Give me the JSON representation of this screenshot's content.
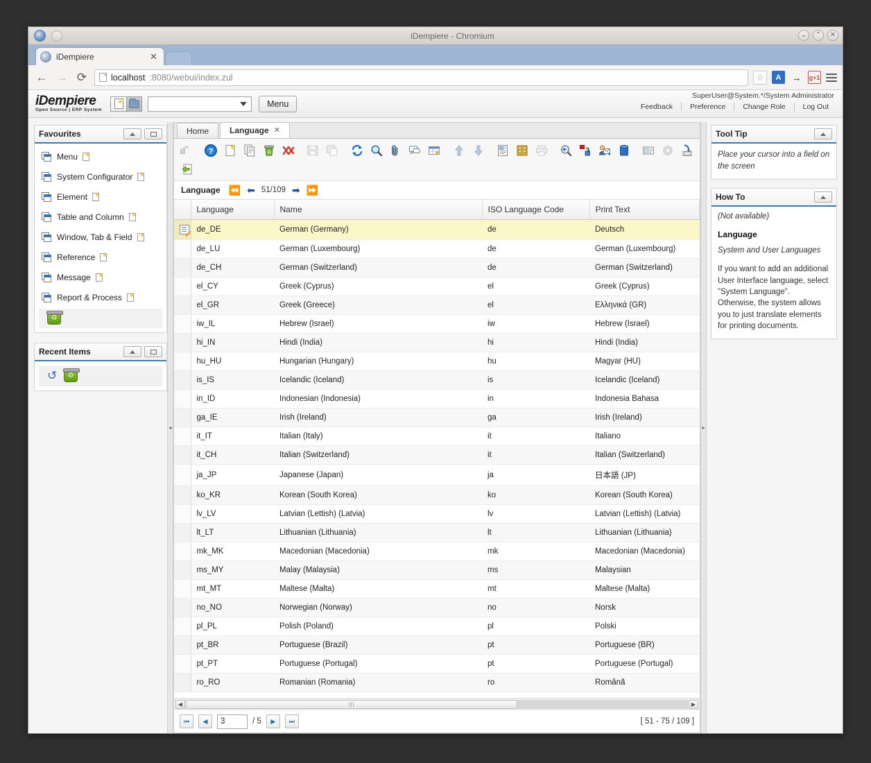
{
  "window": {
    "title": "iDempiere - Chromium",
    "buttons": {
      "minimize": "⌄",
      "maximize": "⌃",
      "close": "✕"
    }
  },
  "browser": {
    "tab_title": "iDempiere",
    "tab_close": "✕",
    "back": "←",
    "forward": "→",
    "reload": "⟳",
    "url_host": "localhost",
    "url_path": ":8080/webui/index.zul",
    "star": "☆",
    "ext_translate": "A",
    "ext_mobile": "→",
    "ext_gplus": "g+1"
  },
  "app_header": {
    "logo_main": "iDempiere",
    "logo_sub": "Open Source | ERP System",
    "search_value": "",
    "menu_button": "Menu",
    "user": "SuperUser@System.*/System Administrator",
    "links": [
      "Feedback",
      "Preference",
      "Change Role",
      "Log Out"
    ]
  },
  "favourites": {
    "title": "Favourites",
    "items": [
      {
        "label": "Menu"
      },
      {
        "label": "System Configurator"
      },
      {
        "label": "Element"
      },
      {
        "label": "Table and Column"
      },
      {
        "label": "Window, Tab & Field"
      },
      {
        "label": "Reference"
      },
      {
        "label": "Message"
      },
      {
        "label": "Report & Process"
      }
    ]
  },
  "recent_items": {
    "title": "Recent Items"
  },
  "tabs": [
    {
      "label": "Home",
      "active": false,
      "closable": false
    },
    {
      "label": "Language",
      "active": true,
      "closable": true,
      "close": "✕"
    }
  ],
  "toolbar": {
    "icons": [
      "ignore-icon",
      "help-icon",
      "new-record-icon",
      "copy-record-icon",
      "delete-record-icon",
      "delete-selection-icon",
      "save-icon",
      "save-create-icon",
      "refresh-icon",
      "find-icon",
      "attachment-icon",
      "chat-icon",
      "grid-toggle-icon",
      "parent-record-icon",
      "detail-record-icon",
      "report-icon",
      "archive-icon",
      "print-icon",
      "zoom-across-icon",
      "active-workflow-icon",
      "request-icon",
      "product-info-icon",
      "customize-icon",
      "process-icon",
      "export-icon",
      "exit-icon"
    ]
  },
  "record_nav": {
    "label": "Language",
    "first": "⏮",
    "prev": "←",
    "counter": "51/109",
    "next": "→",
    "last": "⏭"
  },
  "grid": {
    "columns": [
      "Language",
      "Name",
      "ISO Language Code",
      "Print Text"
    ],
    "rows": [
      {
        "selected": true,
        "cells": [
          "de_DE",
          "German (Germany)",
          "de",
          "Deutsch"
        ]
      },
      {
        "cells": [
          "de_LU",
          "German (Luxembourg)",
          "de",
          "German (Luxembourg)"
        ]
      },
      {
        "cells": [
          "de_CH",
          "German (Switzerland)",
          "de",
          "German (Switzerland)"
        ]
      },
      {
        "cells": [
          "el_CY",
          "Greek (Cyprus)",
          "el",
          "Greek (Cyprus)"
        ]
      },
      {
        "cells": [
          "el_GR",
          "Greek (Greece)",
          "el",
          "Ελληνικά (GR)"
        ]
      },
      {
        "cells": [
          "iw_IL",
          "Hebrew (Israel)",
          "iw",
          "Hebrew (Israel)"
        ]
      },
      {
        "cells": [
          "hi_IN",
          "Hindi (India)",
          "hi",
          "Hindi (India)"
        ]
      },
      {
        "cells": [
          "hu_HU",
          "Hungarian (Hungary)",
          "hu",
          "Magyar (HU)"
        ]
      },
      {
        "cells": [
          "is_IS",
          "Icelandic (Iceland)",
          "is",
          "Icelandic (Iceland)"
        ]
      },
      {
        "cells": [
          "in_ID",
          "Indonesian (Indonesia)",
          "in",
          "Indonesia Bahasa"
        ]
      },
      {
        "cells": [
          "ga_IE",
          "Irish (Ireland)",
          "ga",
          "Irish (Ireland)"
        ]
      },
      {
        "cells": [
          "it_IT",
          "Italian (Italy)",
          "it",
          "Italiano"
        ]
      },
      {
        "cells": [
          "it_CH",
          "Italian (Switzerland)",
          "it",
          "Italian (Switzerland)"
        ]
      },
      {
        "cells": [
          "ja_JP",
          "Japanese (Japan)",
          "ja",
          "日本語 (JP)"
        ]
      },
      {
        "cells": [
          "ko_KR",
          "Korean (South Korea)",
          "ko",
          "Korean (South Korea)"
        ]
      },
      {
        "cells": [
          "lv_LV",
          "Latvian (Lettish) (Latvia)",
          "lv",
          "Latvian (Lettish) (Latvia)"
        ]
      },
      {
        "cells": [
          "lt_LT",
          "Lithuanian (Lithuania)",
          "lt",
          "Lithuanian (Lithuania)"
        ]
      },
      {
        "cells": [
          "mk_MK",
          "Macedonian (Macedonia)",
          "mk",
          "Macedonian (Macedonia)"
        ]
      },
      {
        "cells": [
          "ms_MY",
          "Malay (Malaysia)",
          "ms",
          "Malaysian"
        ]
      },
      {
        "cells": [
          "mt_MT",
          "Maltese (Malta)",
          "mt",
          "Maltese (Malta)"
        ]
      },
      {
        "cells": [
          "no_NO",
          "Norwegian (Norway)",
          "no",
          "Norsk"
        ]
      },
      {
        "cells": [
          "pl_PL",
          "Polish (Poland)",
          "pl",
          "Polski"
        ]
      },
      {
        "cells": [
          "pt_BR",
          "Portuguese (Brazil)",
          "pt",
          "Portuguese (BR)"
        ]
      },
      {
        "cells": [
          "pt_PT",
          "Portuguese (Portugal)",
          "pt",
          "Portuguese (Portugal)"
        ]
      },
      {
        "cells": [
          "ro_RO",
          "Romanian (Romania)",
          "ro",
          "Română"
        ]
      }
    ]
  },
  "pager": {
    "first": "⏮",
    "prev": "◀",
    "page_value": "3",
    "total_pages": "/ 5",
    "next": "▶",
    "last": "⏭",
    "range": "[ 51 - 75 / 109 ]"
  },
  "tooltip_panel": {
    "title": "Tool Tip",
    "text": "Place your cursor into a field on the screen"
  },
  "howto_panel": {
    "title": "How To",
    "not_available": "(Not available)",
    "heading": "Language",
    "subheading": "System and User Languages",
    "body": "If you want to add an additional User Interface language, select \"System Language\". Otherwise, the system allows you to just translate elements for printing documents."
  },
  "colors": {
    "accent": "#3d7ca8",
    "selected_row": "#fcf7c8",
    "link": "#1f4fa0"
  }
}
